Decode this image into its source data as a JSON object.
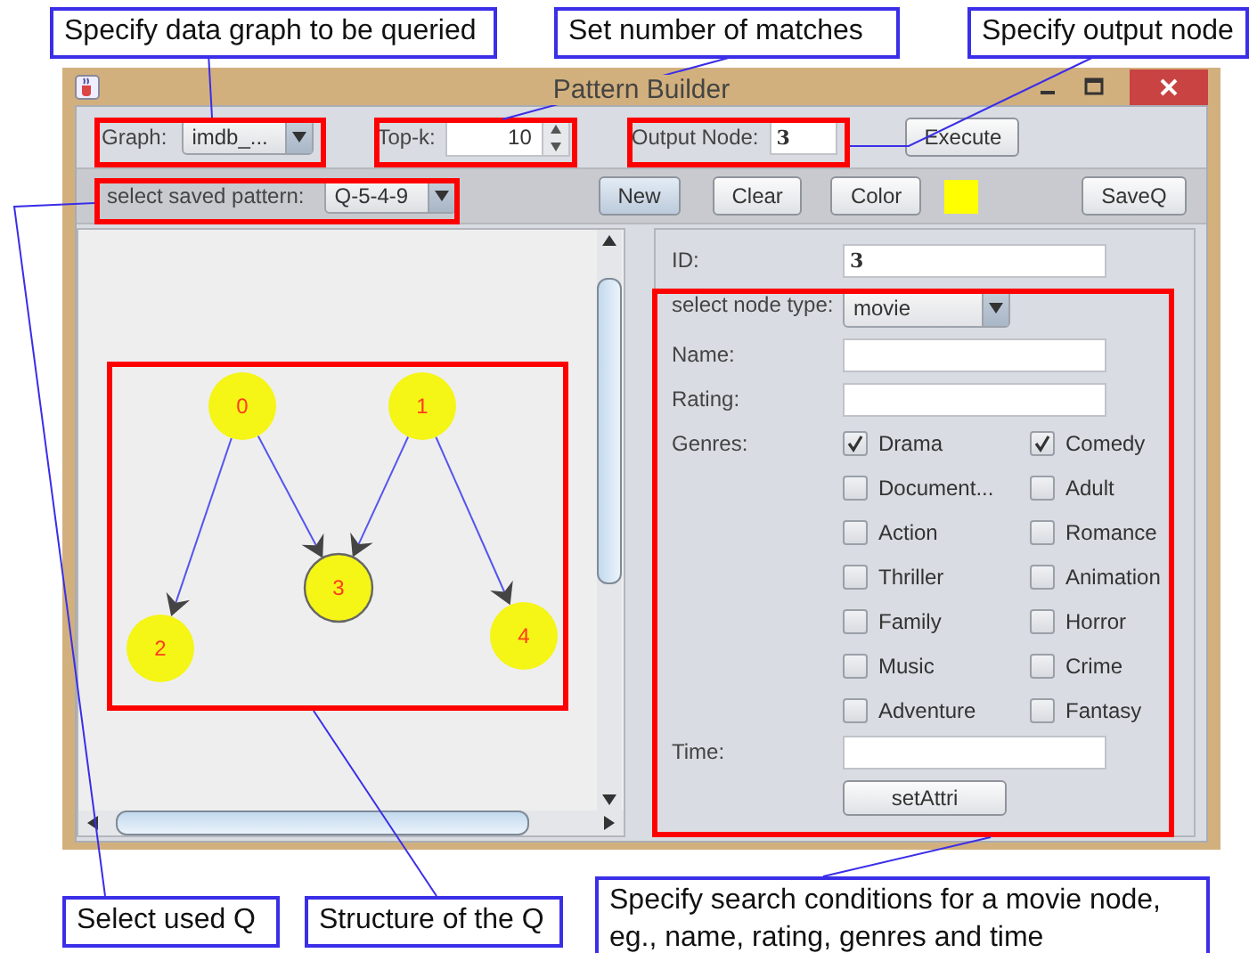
{
  "callouts": [
    {
      "text": "Specify data graph to be queried"
    },
    {
      "text": "Set number of matches"
    },
    {
      "text": "Specify output node"
    },
    {
      "text": "Select used Q"
    },
    {
      "text": "Structure of the Q"
    },
    {
      "text": "Specify search conditions for a movie node, eg., name, rating, genres and time"
    }
  ],
  "window": {
    "title": "Pattern Builder"
  },
  "toolbar": {
    "graph_label": "Graph:",
    "graph_value": "imdb_...",
    "topk_label": "Top-k:",
    "topk_value": "10",
    "output_label": "Output Node:",
    "output_value": "3",
    "execute": "Execute"
  },
  "pattern_bar": {
    "label": "select saved pattern:",
    "value": "Q-5-4-9",
    "buttons": [
      "New",
      "Clear",
      "Color"
    ],
    "save": "SaveQ"
  },
  "graph": {
    "nodes": [
      {
        "label": "0",
        "selected": false
      },
      {
        "label": "1",
        "selected": false
      },
      {
        "label": "2",
        "selected": false
      },
      {
        "label": "3",
        "selected": true
      },
      {
        "label": "4",
        "selected": false
      }
    ]
  },
  "form": {
    "id_label": "ID:",
    "id_value": "3",
    "type_label": "select node type:",
    "type_value": "movie",
    "fields": [
      {
        "label": "Name:"
      },
      {
        "label": "Rating:"
      }
    ],
    "genres_label": "Genres:",
    "genres": [
      {
        "label": "Drama",
        "checked": true
      },
      {
        "label": "Comedy",
        "checked": true
      },
      {
        "label": "Document...",
        "checked": false
      },
      {
        "label": "Adult",
        "checked": false
      },
      {
        "label": "Action",
        "checked": false
      },
      {
        "label": "Romance",
        "checked": false
      },
      {
        "label": "Thriller",
        "checked": false
      },
      {
        "label": "Animation",
        "checked": false
      },
      {
        "label": "Family",
        "checked": false
      },
      {
        "label": "Horror",
        "checked": false
      },
      {
        "label": "Music",
        "checked": false
      },
      {
        "label": "Crime",
        "checked": false
      },
      {
        "label": "Adventure",
        "checked": false
      },
      {
        "label": "Fantasy",
        "checked": false
      }
    ],
    "time_label": "Time:",
    "button": "setAttri"
  }
}
